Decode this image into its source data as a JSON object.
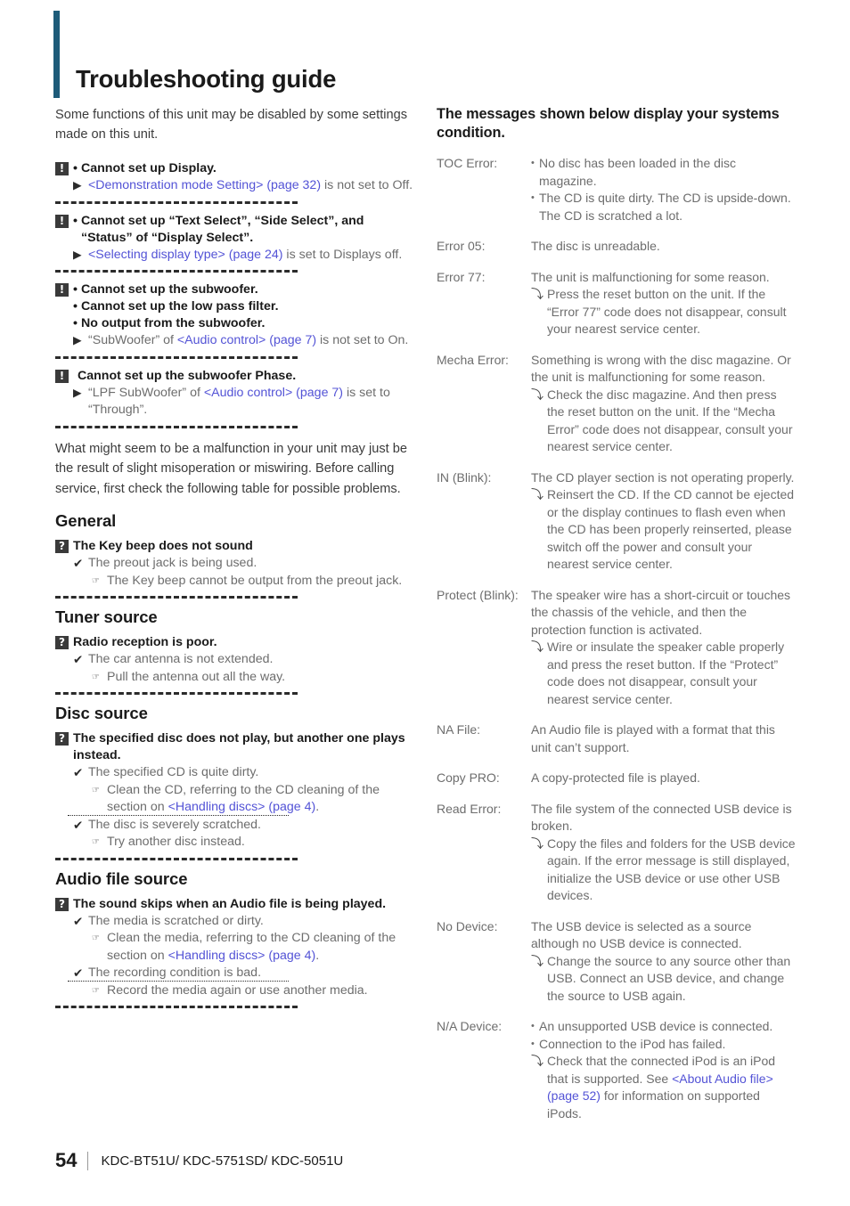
{
  "page": {
    "title": "Troubleshooting guide",
    "accent_color": "#1d5b79",
    "link_color": "#5353d6",
    "badge_color": "#3a3a3a"
  },
  "footer": {
    "page_number": "54",
    "models": "KDC-BT51U/ KDC-5751SD/ KDC-5051U"
  },
  "icons": {
    "warning_badge": "exclamation-badge",
    "question_badge": "question-badge",
    "cause_marker": "check-mark",
    "solution_marker": "pointing-hand",
    "setting_marker": "black-right-triangle",
    "action_marker": "hollow-right-arrow"
  },
  "left": {
    "intro": "Some functions of this unit may be disabled by some settings made on this unit.",
    "settings_blocks": [
      {
        "badge": "!",
        "questions": [
          "Cannot set up Display."
        ],
        "answer_pre": "",
        "answer_link": "<Demonstration mode Setting> (page 32)",
        "answer_post": " is not set to Off."
      },
      {
        "badge": "!",
        "questions": [
          "Cannot set up “Text Select”, “Side Select”, and “Status” of “Display Select”."
        ],
        "answer_pre": "",
        "answer_link": "<Selecting display type> (page 24)",
        "answer_post": " is set to Displays off."
      },
      {
        "badge": "!",
        "questions": [
          "Cannot set up the subwoofer.",
          "Cannot set up the low pass filter.",
          "No output from the subwoofer."
        ],
        "answer_pre": "“SubWoofer” of ",
        "answer_link": "<Audio control> (page 7)",
        "answer_post": " is not set to On."
      },
      {
        "badge": "!",
        "questions_nobullet": [
          "Cannot set up the subwoofer Phase."
        ],
        "answer_pre": "“LPF SubWoofer” of ",
        "answer_link": "<Audio control> (page 7)",
        "answer_post": " is set to “Through”."
      }
    ],
    "intro2": "What might seem to be a malfunction in your unit may just be the result of slight misoperation or miswiring. Before calling service, first check the following table for possible problems.",
    "sections": [
      {
        "heading": "General",
        "items": [
          {
            "badge": "?",
            "question": "The Key beep does not sound",
            "causes": [
              {
                "cause": "The preout jack is being used.",
                "solutions": [
                  "The Key beep cannot be output from the preout jack."
                ]
              }
            ]
          }
        ]
      },
      {
        "heading": "Tuner source",
        "items": [
          {
            "badge": "?",
            "question": "Radio reception is poor.",
            "causes": [
              {
                "cause": "The car antenna is not extended.",
                "solutions": [
                  "Pull the antenna out all the way."
                ]
              }
            ]
          }
        ]
      },
      {
        "heading": "Disc source",
        "items": [
          {
            "badge": "?",
            "question": "The specified disc does not play, but another one plays instead.",
            "causes": [
              {
                "cause": "The specified CD is quite dirty.",
                "solution_pre": "Clean the CD, referring to the CD cleaning of the section on ",
                "solution_link": "<Handling discs> (page 4)",
                "solution_post": "."
              },
              {
                "cause": "The disc is severely scratched.",
                "solutions": [
                  "Try another disc instead."
                ]
              }
            ]
          }
        ]
      },
      {
        "heading": "Audio file source",
        "items": [
          {
            "badge": "?",
            "question": "The sound skips when an Audio file is being played.",
            "causes": [
              {
                "cause": "The media is scratched or dirty.",
                "solution_pre": "Clean the media, referring to the CD cleaning of the section on ",
                "solution_link": "<Handling discs> (page 4)",
                "solution_post": "."
              },
              {
                "cause": "The recording condition is bad.",
                "solutions": [
                  "Record the media again or use another media."
                ]
              }
            ]
          }
        ]
      }
    ]
  },
  "right": {
    "heading": "The messages shown below display your systems condition.",
    "messages": [
      {
        "term": "TOC Error:",
        "bullets": [
          "No disc has been loaded in the disc magazine.",
          "The CD is quite dirty. The CD is upside-down. The CD is scratched a lot."
        ]
      },
      {
        "term": "Error 05:",
        "text": "The disc is unreadable."
      },
      {
        "term": "Error 77:",
        "text": "The unit is malfunctioning for some reason.",
        "action": "Press the reset button on the unit. If the “Error 77” code does not disappear, consult your nearest service center."
      },
      {
        "term": "Mecha Error:",
        "text": "Something is wrong with the disc magazine. Or the unit is malfunctioning for some reason.",
        "action": "Check the disc magazine. And then press the reset button on the unit. If the “Mecha Error” code does not disappear, consult your nearest service center."
      },
      {
        "term": "IN (Blink):",
        "text": "The CD player section is not operating properly.",
        "action": "Reinsert the CD. If the CD cannot be ejected or the display continues to flash even when the CD has been properly reinserted, please switch off the power and consult your nearest service center."
      },
      {
        "term": "Protect (Blink):",
        "text": "The speaker wire has a short-circuit or touches the chassis of the vehicle, and then the protection function is activated.",
        "action": "Wire or insulate the speaker cable properly and press the reset button. If the “Protect” code does not disappear, consult your nearest service center."
      },
      {
        "term": "NA File:",
        "text": "An Audio file is played with a format that this unit can’t support."
      },
      {
        "term": "Copy PRO:",
        "text": "A copy-protected file is played."
      },
      {
        "term": "Read Error:",
        "text": "The file system of the connected USB device is broken.",
        "action": "Copy the files and folders for the USB device again. If the error message is still displayed, initialize the USB device or use other USB devices."
      },
      {
        "term": "No Device:",
        "text": "The USB device is selected as a source although no USB device is connected.",
        "action": "Change the source to any source other than USB. Connect an USB device, and change the source to USB again."
      },
      {
        "term": "N/A Device:",
        "bullets": [
          "An unsupported USB device is connected.",
          "Connection to the iPod has failed."
        ],
        "action_pre": "Check that the connected iPod is an iPod that is supported. See ",
        "action_link": "<About Audio file> (page 52)",
        "action_post": " for information on supported iPods."
      }
    ]
  }
}
